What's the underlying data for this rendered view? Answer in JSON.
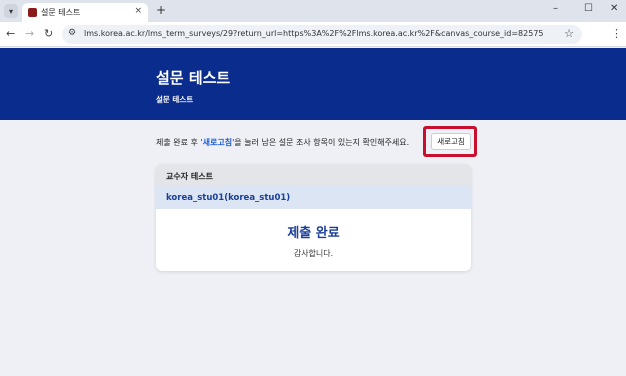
{
  "browser": {
    "tab_title": "설문 테스트",
    "tab_close": "×",
    "new_tab": "+",
    "url": "lms.korea.ac.kr/lms_term_surveys/29?return_url=https%3A%2F%2Flms.korea.ac.kr%2F&canvas_course_id=82575",
    "icons": {
      "tab_menu": "chevron-down-icon",
      "back": "back-arrow-icon",
      "forward": "forward-arrow-icon",
      "reload": "reload-icon",
      "site_info": "site-info-icon",
      "bookmark": "star-icon",
      "menu": "kebab-menu-icon",
      "minimize": "minimize-icon",
      "maximize": "maximize-icon",
      "close": "close-icon"
    }
  },
  "header": {
    "title": "설문 테스트",
    "subtitle": "설문 테스트"
  },
  "notice": {
    "before": "제출 완료 후 '",
    "highlight": "새로고침",
    "after": "'을 눌러 남은 설문 조사 항목이 있는지 확인해주세요.",
    "refresh_button": "새로고침"
  },
  "card": {
    "instructor": "교수자 테스트",
    "student": "korea_stu01(korea_stu01)",
    "status_title": "제출 완료",
    "status_message": "감사합니다."
  },
  "colors": {
    "banner": "#0a2c8c",
    "highlight": "#1f5fd6",
    "accent_frame": "#c8102e",
    "student_row": "#dce5f4"
  }
}
